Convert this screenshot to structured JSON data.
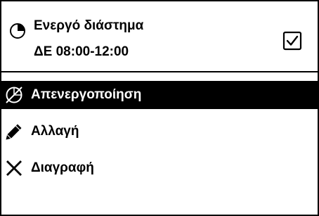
{
  "header": {
    "title": "Ενεργό διάστημα",
    "subtitle": "ΔΕ 08:00-12:00",
    "checkbox_checked": true,
    "icon": "clock-icon"
  },
  "menu": {
    "items": [
      {
        "label": "Απενεργοποίηση",
        "icon": "disabled-clock-icon",
        "selected": true
      },
      {
        "label": "Αλλαγή",
        "icon": "pencil-icon",
        "selected": false
      },
      {
        "label": "Διαγραφή",
        "icon": "cross-icon",
        "selected": false
      }
    ]
  },
  "colors": {
    "background": "#ffffff",
    "foreground": "#000000",
    "selection_background": "#000000",
    "selection_text": "#ffffff"
  }
}
